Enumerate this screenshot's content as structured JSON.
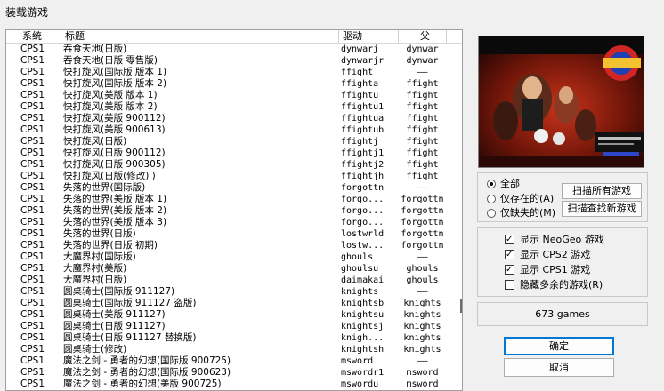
{
  "window": {
    "title": "装载游戏"
  },
  "list": {
    "columns": [
      "系统",
      "标题",
      "驱动",
      "父"
    ],
    "rows": [
      [
        "CPS1",
        "吞食天地(日版)",
        "dynwarj",
        "dynwar"
      ],
      [
        "CPS1",
        "吞食天地(日版 零售版)",
        "dynwarjr",
        "dynwar"
      ],
      [
        "CPS1",
        "快打旋风(国际版 版本 1)",
        "ffight",
        "——"
      ],
      [
        "CPS1",
        "快打旋风(国际版 版本 2)",
        "ffighta",
        "ffight"
      ],
      [
        "CPS1",
        "快打旋风(美版  版本 1)",
        "ffightu",
        "ffight"
      ],
      [
        "CPS1",
        "快打旋风(美版  版本 2)",
        "ffightu1",
        "ffight"
      ],
      [
        "CPS1",
        "快打旋风(美版 900112)",
        "ffightua",
        "ffight"
      ],
      [
        "CPS1",
        "快打旋风(美版 900613)",
        "ffightub",
        "ffight"
      ],
      [
        "CPS1",
        "快打旋风(日版)",
        "ffightj",
        "ffight"
      ],
      [
        "CPS1",
        "快打旋风(日版 900112)",
        "ffightj1",
        "ffight"
      ],
      [
        "CPS1",
        "快打旋风(日版 900305)",
        "ffightj2",
        "ffight"
      ],
      [
        "CPS1",
        "快打旋风(日版(修改)  )",
        "ffightjh",
        "ffight"
      ],
      [
        "CPS1",
        "失落的世界(国际版)",
        "forgottn",
        "——"
      ],
      [
        "CPS1",
        "失落的世界(美版 版本 1)",
        "forgo...",
        "forgottn"
      ],
      [
        "CPS1",
        "失落的世界(美版 版本 2)",
        "forgo...",
        "forgottn"
      ],
      [
        "CPS1",
        "失落的世界(美版 版本 3)",
        "forgo...",
        "forgottn"
      ],
      [
        "CPS1",
        "失落的世界(日版)",
        "lostwrld",
        "forgottn"
      ],
      [
        "CPS1",
        "失落的世界(日版 初期)",
        "lostw...",
        "forgottn"
      ],
      [
        "CPS1",
        "大魔界村(国际版)",
        "ghouls",
        "——"
      ],
      [
        "CPS1",
        "大魔界村(美版)",
        "ghoulsu",
        "ghouls"
      ],
      [
        "CPS1",
        "大魔界村(日版)",
        "daimakai",
        "ghouls"
      ],
      [
        "CPS1",
        "圆桌骑士(国际版 911127)",
        "knights",
        "——"
      ],
      [
        "CPS1",
        "圆桌骑士(国际版 911127 盗版)",
        "knightsb",
        "knights"
      ],
      [
        "CPS1",
        "圆桌骑士(美版 911127)",
        "knightsu",
        "knights"
      ],
      [
        "CPS1",
        "圆桌骑士(日版 911127)",
        "knightsj",
        "knights"
      ],
      [
        "CPS1",
        "圆桌骑士(日版 911127 替换版)",
        "knigh...",
        "knights"
      ],
      [
        "CPS1",
        "圆桌骑士(修改)",
        "knightsh",
        "knights"
      ],
      [
        "CPS1",
        "魔法之剑 - 勇者的幻想(国际版 900725)",
        "msword",
        "——"
      ],
      [
        "CPS1",
        "魔法之剑 - 勇者的幻想(国际版 900623)",
        "mswordr1",
        "msword"
      ],
      [
        "CPS1",
        "魔法之剑 - 勇者的幻想(美版  900725)",
        "mswordu",
        "msword"
      ]
    ]
  },
  "filter": {
    "radio_all": "全部",
    "radio_available": "仅存在的(A)",
    "radio_missing": "仅缺失的(M)",
    "scan_all": "扫描所有游戏",
    "scan_new": "扫描查找新游戏"
  },
  "options": {
    "neogeo": "显示 NeoGeo 游戏",
    "cps2": "显示 CPS2 游戏",
    "cps1": "显示 CPS1 游戏",
    "hide_extra": "隐藏多余的游戏(R)"
  },
  "status": {
    "count": "673 games"
  },
  "actions": {
    "ok": "确定",
    "cancel": "取消"
  },
  "colors": {
    "accent": "#0078d7"
  }
}
